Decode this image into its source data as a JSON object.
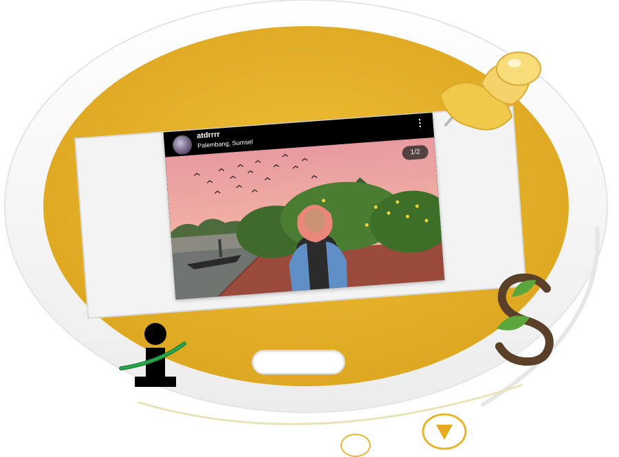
{
  "post": {
    "username": "atdrrrr",
    "location": "Palembang, Sumsel",
    "counter": "1/2",
    "menu_glyph": "⋮"
  },
  "logos": {
    "left": "info-logo",
    "right": "leaf-s-logo"
  },
  "colors": {
    "tablet_gold": "#e7b42a",
    "pin_yellow": "#f1c94a",
    "leaf_green": "#5aa63a",
    "logo_green": "#1e8a3c"
  }
}
